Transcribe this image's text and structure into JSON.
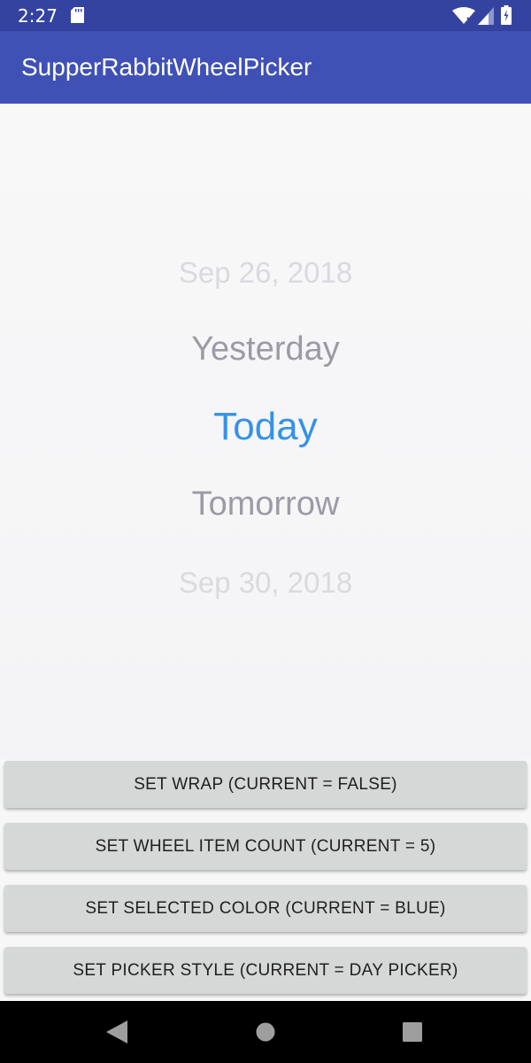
{
  "status_bar": {
    "time": "2:27",
    "icons": [
      "sd-card-icon",
      "wifi-icon",
      "signal-icon",
      "battery-icon"
    ]
  },
  "app_bar": {
    "title": "SupperRabbitWheelPicker"
  },
  "wheel": {
    "items": [
      "Sep 26, 2018",
      "Yesterday",
      "Today",
      "Tomorrow",
      "Sep 30, 2018"
    ],
    "selected_index": 2,
    "selected_color": "#3592e7"
  },
  "buttons": {
    "wrap": "SET WRAP (CURRENT = FALSE)",
    "item_count": "SET WHEEL ITEM COUNT (CURRENT = 5)",
    "selected_color": "SET SELECTED COLOR (CURRENT = BLUE)",
    "picker_style": "SET PICKER STYLE (CURRENT = DAY PICKER)"
  },
  "nav_bar": {
    "icons": [
      "back-icon",
      "home-icon",
      "recents-icon"
    ]
  },
  "colors": {
    "status_bar": "#3443a0",
    "app_bar": "#3f51b5",
    "button_bg": "#d6d7d7"
  }
}
